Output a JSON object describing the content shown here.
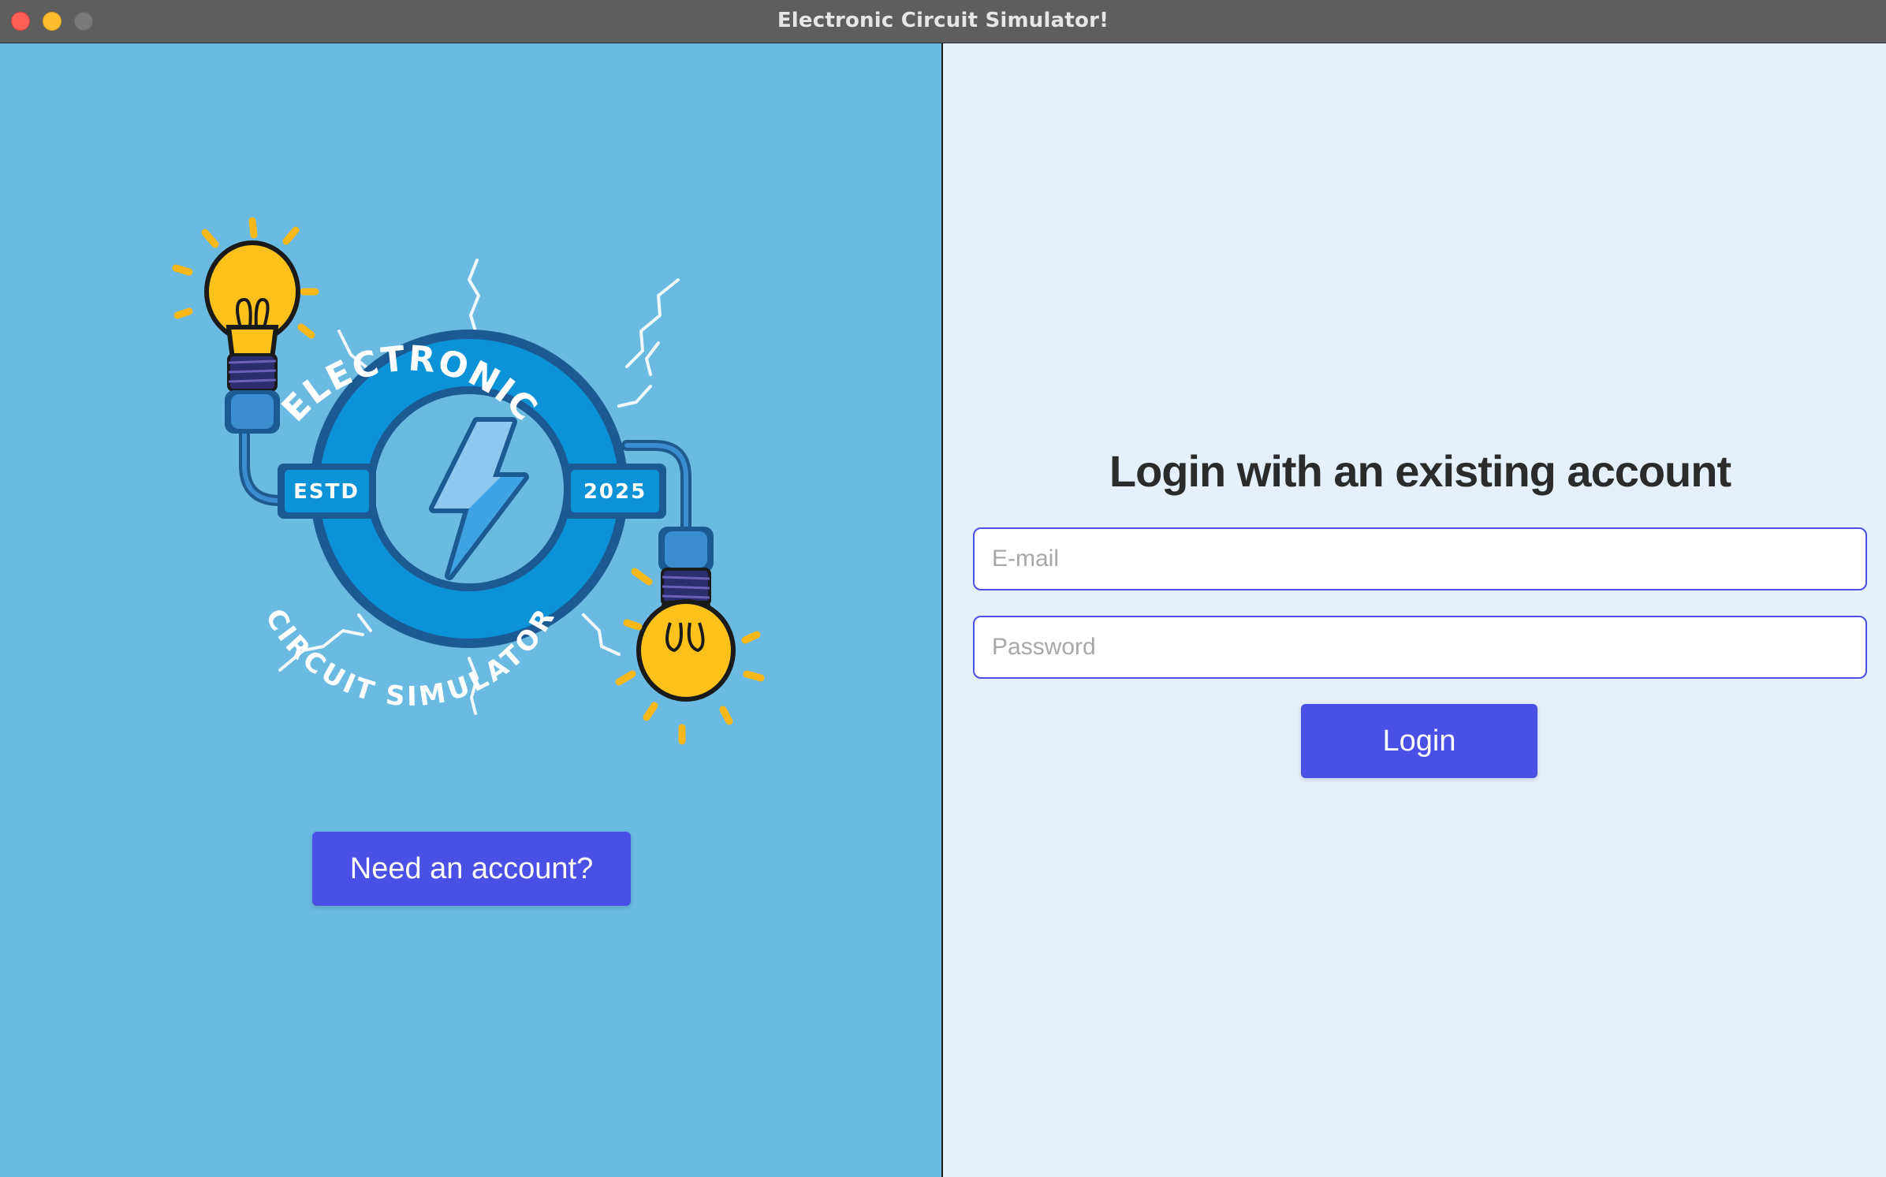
{
  "window": {
    "title": "Electronic Circuit Simulator!"
  },
  "logo": {
    "top_text": "ELECTRONIC",
    "bottom_text": "CIRCUIT SIMULATOR",
    "left_badge": "ESTD",
    "right_badge": "2025"
  },
  "left": {
    "need_account_label": "Need an account?"
  },
  "login": {
    "heading": "Login with an existing account",
    "email_placeholder": "E-mail",
    "password_placeholder": "Password",
    "button_label": "Login"
  },
  "colors": {
    "left_background": "#6abae1",
    "right_background": "#e4f1fc",
    "accent_button": "#4a4fe6",
    "heading_text": "#2b2b2b"
  },
  "icons": [
    "close-icon",
    "minimize-icon",
    "zoom-icon",
    "lightning-bolt-icon",
    "light-bulb-icon"
  ]
}
